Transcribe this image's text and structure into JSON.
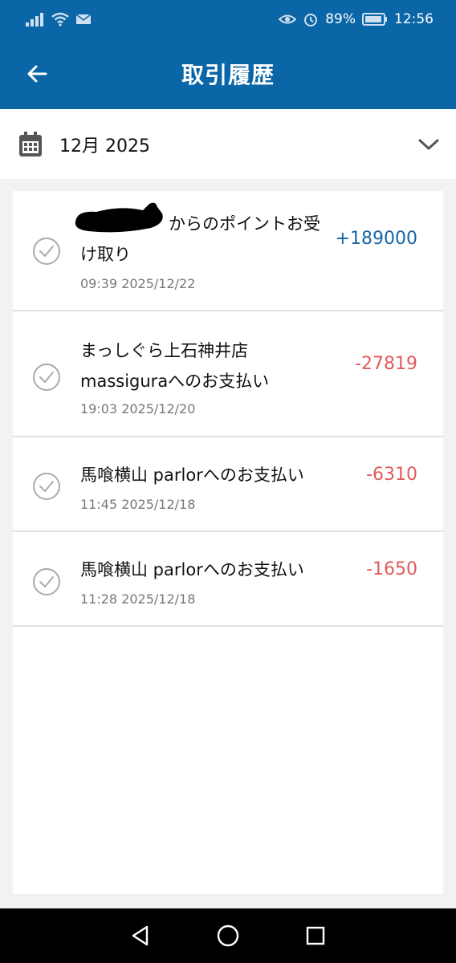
{
  "status_bar": {
    "battery": "89%",
    "time": "12:56"
  },
  "header": {
    "title": "取引履歴",
    "back_icon": "arrow-left-icon"
  },
  "month_selector": {
    "label": "12月 2025",
    "calendar_icon": "calendar-icon",
    "chevron_icon": "chevron-down-icon"
  },
  "transactions": [
    {
      "title": "からのポイントお受け取り",
      "time": "09:39 2025/12/22",
      "amount": "+189000",
      "type": "positive"
    },
    {
      "title": "まっしぐら上石神井店massiguraへのお支払い",
      "time": "19:03 2025/12/20",
      "amount": "-27819",
      "type": "negative"
    },
    {
      "title": "馬喰横山 parlorへのお支払い",
      "time": "11:45 2025/12/18",
      "amount": "-6310",
      "type": "negative"
    },
    {
      "title": "馬喰横山 parlorへのお支払い",
      "time": "11:28 2025/12/18",
      "amount": "-1650",
      "type": "negative"
    }
  ],
  "colors": {
    "primary": "#0a66a6",
    "positive": "#1565a8",
    "negative": "#e05a5a"
  },
  "nav_bar": {
    "back_icon": "triangle-back-icon",
    "home_icon": "circle-home-icon",
    "recents_icon": "square-recents-icon"
  }
}
